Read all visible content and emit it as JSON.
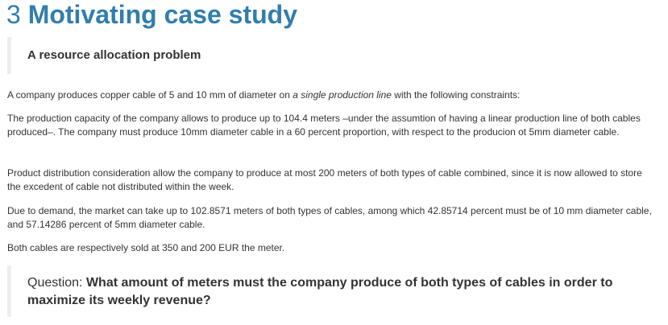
{
  "section": {
    "number": "3",
    "title": "Motivating case study"
  },
  "callout_heading": "A resource allocation problem",
  "paragraphs": {
    "p1": {
      "before": "A company produces copper cable of 5 and 10 mm of diameter on ",
      "emphasis": "a single production line",
      "after": " with the following constraints:"
    },
    "p2": "The production capacity of the company allows to produce up to 104.4 meters –under the assumtion of having a linear production line of both cables produced–. The company must produce 10mm diameter cable in a 60 percent proportion, with respect to the producion ot 5mm diameter cable.",
    "p3": "Product distribution consideration allow the company to produce at most 200 meters of both types of cable combined, since it is now allowed to store the excedent of cable not distributed within the week.",
    "p4": "Due to demand, the market can take up to 102.8571 meters of both types of cables, among which 42.85714 percent must be of 10 mm diameter cable, and 57.14286 percent of 5mm diameter cable.",
    "p5": "Both cables are respectively sold at 350 and 200 EUR the meter."
  },
  "question": {
    "label": "Question: ",
    "text": "What amount of meters must the company produce of both types of cables in order to maximize its weekly revenue?"
  },
  "colors": {
    "heading": "#317eac",
    "text": "#333333",
    "callout_border": "#eeeeee"
  }
}
